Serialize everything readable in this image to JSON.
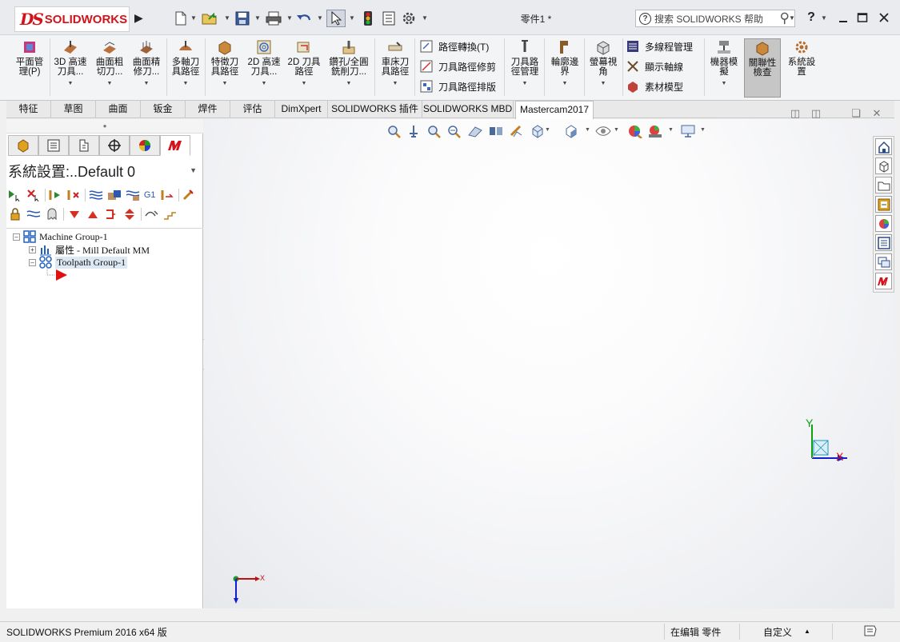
{
  "app": {
    "logo_ds": "DS",
    "logo_brand": "SOLIDWORKS",
    "document_title": "零件1 *",
    "search_placeholder": "搜索 SOLIDWORKS 帮助",
    "help_label": "?"
  },
  "ribbon": {
    "buttons": [
      {
        "line1": "平面管",
        "line2": "理(P)"
      },
      {
        "line1": "3D 高速",
        "line2": "刀具..."
      },
      {
        "line1": "曲面粗",
        "line2": "切刀..."
      },
      {
        "line1": "曲面精",
        "line2": "修刀..."
      },
      {
        "line1": "多軸刀",
        "line2": "具路徑"
      },
      {
        "line1": "特徵刀",
        "line2": "具路徑"
      },
      {
        "line1": "2D 高速",
        "line2": "刀具..."
      },
      {
        "line1": "2D 刀具",
        "line2": "路徑"
      },
      {
        "line1": "鑽孔/全圓",
        "line2": "銑削刀..."
      },
      {
        "line1": "車床刀",
        "line2": "具路徑"
      }
    ],
    "small_group1": [
      "路徑轉換(T)",
      "刀具路徑修剪",
      "刀具路徑排版"
    ],
    "buttons2": [
      {
        "line1": "刀具路",
        "line2": "徑管理"
      },
      {
        "line1": "輪廓邊",
        "line2": "界"
      },
      {
        "line1": "螢幕視",
        "line2": "角"
      }
    ],
    "small_group2": [
      "多線程管理",
      "顯示軸線",
      "素材模型"
    ],
    "buttons3": [
      {
        "line1": "機器模",
        "line2": "擬"
      },
      {
        "line1": "關聯性",
        "line2": "檢查"
      },
      {
        "line1": "系統設",
        "line2": "置"
      }
    ]
  },
  "tabs": [
    "特征",
    "草图",
    "曲面",
    "钣金",
    "焊件",
    "评估",
    "DimXpert",
    "SOLIDWORKS 插件",
    "SOLIDWORKS MBD",
    "Mastercam2017"
  ],
  "panel": {
    "title": "系統設置:..Default 0",
    "tree": {
      "root": "Machine Group-1",
      "props": "屬性 - Mill Default MM",
      "toolpath_group": "Toolpath Group-1"
    }
  },
  "axes": {
    "x": "X",
    "y": "Y",
    "x_small": "X"
  },
  "status": {
    "product": "SOLIDWORKS Premium 2016 x64 版",
    "editing": "在编辑 零件",
    "custom": "自定义"
  },
  "colors": {
    "brand_red": "#d3131b",
    "axis_x": "#e01010",
    "axis_y": "#12a012",
    "axis_z": "#1020d0"
  }
}
